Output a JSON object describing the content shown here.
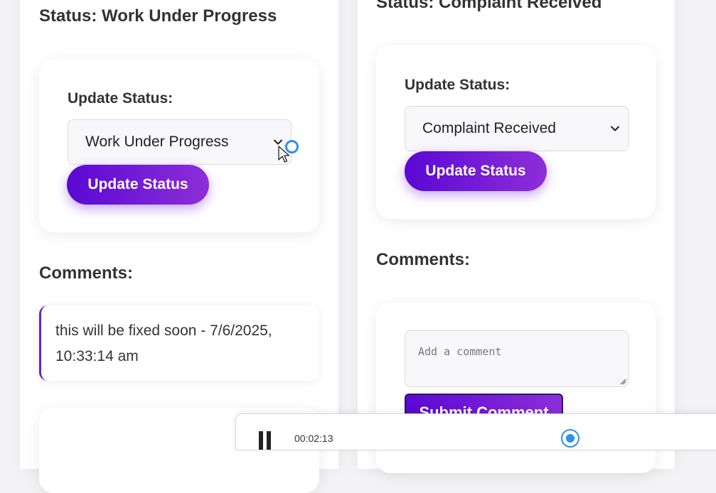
{
  "left_panel": {
    "status_heading": "Status: Work Under Progress",
    "update_label": "Update Status:",
    "select_value": "Work Under Progress",
    "update_button": "Update Status",
    "comments_heading": "Comments:",
    "comments": [
      {
        "text": "this will be fixed soon - 7/6/2025, 10:33:14 am"
      }
    ]
  },
  "right_panel": {
    "status_heading": "Status: Complaint Received",
    "update_label": "Update Status:",
    "select_value": "Complaint Received",
    "update_button": "Update Status",
    "comments_heading": "Comments:",
    "comment_placeholder": "Add a comment",
    "submit_button": "Submit Comment"
  },
  "player": {
    "time": "00:02:13",
    "pause_icon": "pause-icon"
  },
  "colors": {
    "accent_start": "#5a08d4",
    "accent_end": "#8d2ed8",
    "comment_border": "#6a1fd6",
    "cursor_ring": "#2f8ff0"
  }
}
